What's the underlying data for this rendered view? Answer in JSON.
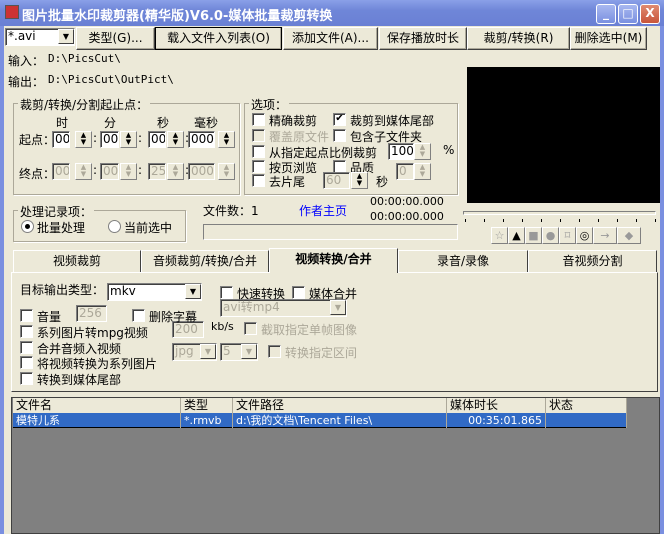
{
  "window": {
    "title": "图片批量水印裁剪器(精华版)V6.0-媒体批量裁剪转换",
    "min": "_",
    "max": "□",
    "close": "X"
  },
  "toolbar": {
    "filter": "*.avi",
    "type": "类型(G)...",
    "load": "载入文件入列表(O)",
    "add": "添加文件(A)...",
    "save_duration": "保存播放时长",
    "cut_convert": "裁剪/转换(R)",
    "delete_selected": "删除选中(M)"
  },
  "paths": {
    "input_label": "输入：",
    "input": "D:\\PicsCut\\",
    "output_label": "输出：",
    "output": "D:\\PicsCut\\OutPict\\"
  },
  "crop": {
    "title": "裁剪/转换/分割起止点：",
    "h": "时",
    "m": "分",
    "s": "秒",
    "ms": "毫秒",
    "start_label": "起点：",
    "end_label": "终点：",
    "start": [
      "00",
      "00",
      "00",
      "000"
    ],
    "end": [
      "00",
      "00",
      "25",
      "000"
    ]
  },
  "options": {
    "title": "选项：",
    "precise": "精确裁剪",
    "to_end": "裁剪到媒体尾部",
    "overwrite": "覆盖原文件",
    "subfolders": "包含子文件夹",
    "ratio": "从指定起点比例裁剪",
    "ratio_value": "100",
    "percent": "%",
    "page_view": "按页浏览",
    "quality": "品质",
    "quality_value": "0",
    "trim_tail": "去片尾",
    "tail_value": "60",
    "sec": "秒"
  },
  "process": {
    "title": "处理记录项：",
    "batch": "批量处理",
    "current": "当前选中"
  },
  "status": {
    "file_count": "文件数：1",
    "author": "作者主页",
    "time1": "00:00:00.000",
    "time2": "00:00:00.000",
    "author_color": "#0000ff"
  },
  "tabs": [
    "视频裁剪",
    "音频裁剪/转换/合并",
    "视频转换/合并",
    "录音/录像",
    "音视频分割"
  ],
  "convert": {
    "target_label": "目标输出类型：",
    "target": "mkv",
    "fast": "快速转换",
    "merge": "媒体合并",
    "preset": "avi转mp4",
    "volume": "音量",
    "volume_value": "256",
    "remove_sub": "删除字幕",
    "img_to_mpg": "系列图片转mpg视频",
    "bitrate": "200",
    "kbs": "kb/s",
    "capture_frame": "截取指定单帧图像",
    "merge_audio": "合并音频入视频",
    "img_fmt": "jpg",
    "img_num": "5",
    "convert_range": "转换指定区间",
    "to_images": "将视频转换为系列图片",
    "to_media_end": "转换到媒体尾部"
  },
  "list": {
    "columns": [
      "文件名",
      "类型",
      "文件路径",
      "媒体时长",
      "状态"
    ],
    "rows": [
      [
        "模特儿系",
        "*.rmvb",
        "d:\\我的文档\\Tencent Files\\",
        "00:35:01.865",
        ""
      ]
    ],
    "select_color": "#316ac5"
  },
  "player": {
    "shapes": [
      "star-icon",
      "triangle-icon",
      "square-icon",
      "circle-icon",
      "frame-icon",
      "target-icon",
      "arrow-icon",
      "diamond-icon"
    ],
    "glyphs": [
      "☆",
      "▲",
      "■",
      "●",
      "⌑",
      "◎",
      "→",
      "◆"
    ]
  }
}
